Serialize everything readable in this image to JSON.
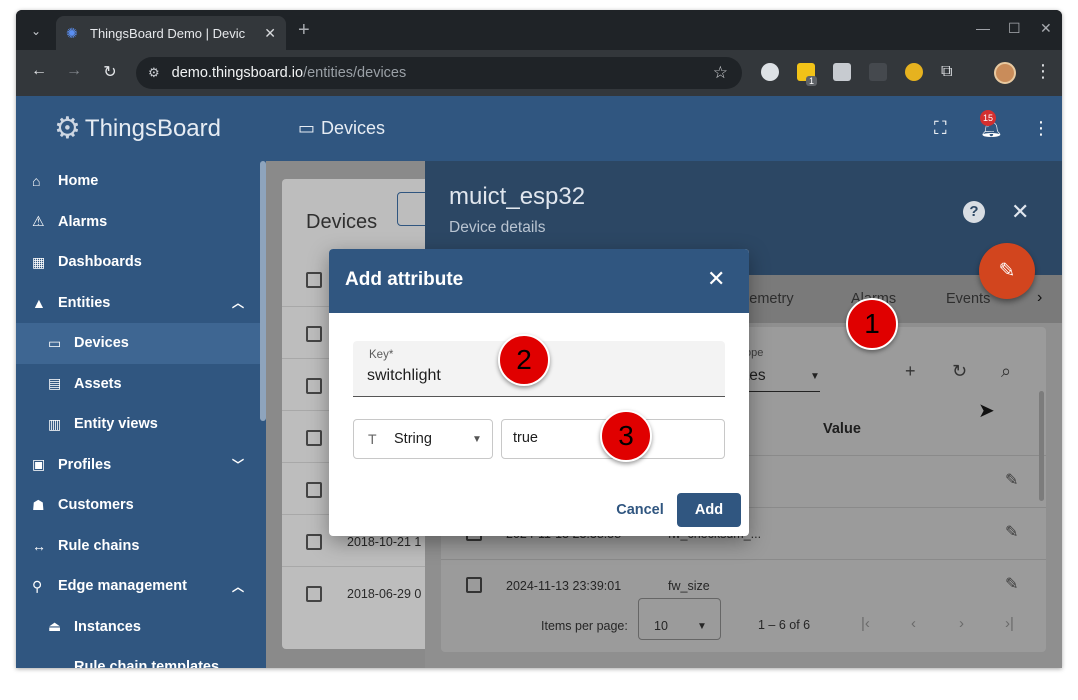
{
  "browser": {
    "tab_title": "ThingsBoard Demo | Devic",
    "url_host": "demo.thingsboard.io",
    "url_path": "/entities/devices",
    "extension_badge": "1"
  },
  "app": {
    "logo_text": "ThingsBoard",
    "page_title": "Devices",
    "notification_count": "15",
    "sidebar": [
      {
        "label": "Home",
        "icon": "home-icon"
      },
      {
        "label": "Alarms",
        "icon": "warning-icon"
      },
      {
        "label": "Dashboards",
        "icon": "dashboard-icon"
      },
      {
        "label": "Entities",
        "icon": "entities-icon"
      },
      {
        "label": "Devices",
        "icon": "devices-icon"
      },
      {
        "label": "Assets",
        "icon": "assets-icon"
      },
      {
        "label": "Entity views",
        "icon": "entity-views-icon"
      },
      {
        "label": "Profiles",
        "icon": "profiles-icon"
      },
      {
        "label": "Customers",
        "icon": "customers-icon"
      },
      {
        "label": "Rule chains",
        "icon": "rule-chains-icon"
      },
      {
        "label": "Edge management",
        "icon": "edge-icon"
      },
      {
        "label": "Instances",
        "icon": "instances-icon"
      },
      {
        "label": "Rule chain templates",
        "icon": "rule-chain-templates-icon"
      }
    ]
  },
  "devices_list": {
    "title": "Devices",
    "rows": [
      {
        "date": "2018-10-21 1"
      },
      {
        "date": "2018-06-29 0"
      }
    ]
  },
  "detail": {
    "title": "muict_esp32",
    "subtitle": "Device details",
    "tabs": [
      "elemetry",
      "Alarms",
      "Events"
    ],
    "scope_label": "ope",
    "scope_value": "tes",
    "value_column": "Value",
    "rows": [
      {
        "date": "2024-11-13 23:38:58",
        "key": "fw_checksum_..."
      },
      {
        "date": "2024-11-13 23:39:01",
        "key": "fw_size"
      }
    ],
    "items_per_page_label": "Items per page:",
    "items_per_page": "10",
    "range": "1 – 6 of 6"
  },
  "dialog": {
    "title": "Add attribute",
    "key_label": "Key*",
    "key_value": "switchlight",
    "type_value": "String",
    "value_value": "true",
    "cancel_label": "Cancel",
    "add_label": "Add"
  },
  "markers": [
    "1",
    "2",
    "3"
  ]
}
